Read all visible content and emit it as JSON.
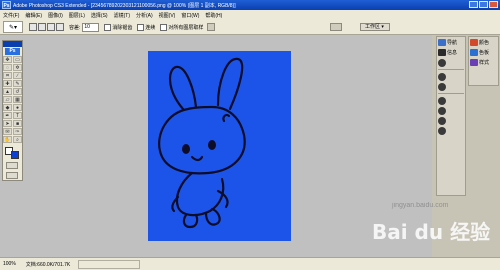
{
  "titlebar": {
    "app_icon": "Ps",
    "title": "Adobe Photoshop CS3 Extended - [23456789202303121100056.png @ 100% (图层 1 副本, RGB/8)]"
  },
  "menubar": {
    "items": [
      "文件(F)",
      "编辑(E)",
      "图像(I)",
      "图层(L)",
      "选择(S)",
      "滤镜(T)",
      "分析(A)",
      "视图(V)",
      "窗口(W)",
      "帮助(H)"
    ]
  },
  "options": {
    "feather_label": "容差:",
    "feather_value": "10",
    "antialias_label": "消除锯齿",
    "contiguous_label": "连续",
    "all_layers_label": "对所有图层取样",
    "workspace_label": "工作区 ▾"
  },
  "toolbox": {
    "logo": "Ps"
  },
  "status": {
    "zoom": "100%",
    "docinfo": "文档:660.0K/701.7K"
  },
  "panels": {
    "col1": [
      {
        "label": "导航",
        "icon": "navigator-icon",
        "color": "#3c6fc7"
      },
      {
        "label": "信息",
        "icon": "info-icon",
        "color": "#2b2b2b"
      },
      {
        "label": "",
        "icon": "histogram-icon",
        "color": "#2b2b2b"
      },
      {
        "label": "",
        "icon": "history-icon",
        "color": "#2b2b2b"
      },
      {
        "label": "",
        "icon": "actions-icon",
        "color": "#2b2b2b"
      },
      {
        "label": "",
        "icon": "tool-presets-icon",
        "color": "#2b2b2b"
      },
      {
        "label": "",
        "icon": "layer-comps-icon",
        "color": "#2b2b2b"
      },
      {
        "label": "",
        "icon": "brushes-icon",
        "color": "#2b2b2b"
      },
      {
        "label": "",
        "icon": "clone-source-icon",
        "color": "#2b2b2b"
      }
    ],
    "col2": [
      {
        "label": "颜色",
        "icon": "color-icon",
        "color": "#d24a2b"
      },
      {
        "label": "色板",
        "icon": "swatches-icon",
        "color": "#2b6fd2"
      },
      {
        "label": "样式",
        "icon": "styles-icon",
        "color": "#6a3fb5"
      }
    ]
  },
  "canvas": {
    "background": "#1c54ea",
    "subject": "rabbit-drawing"
  },
  "watermark": {
    "logo": "Bai du 经验",
    "url": "jingyan.baidu.com"
  }
}
